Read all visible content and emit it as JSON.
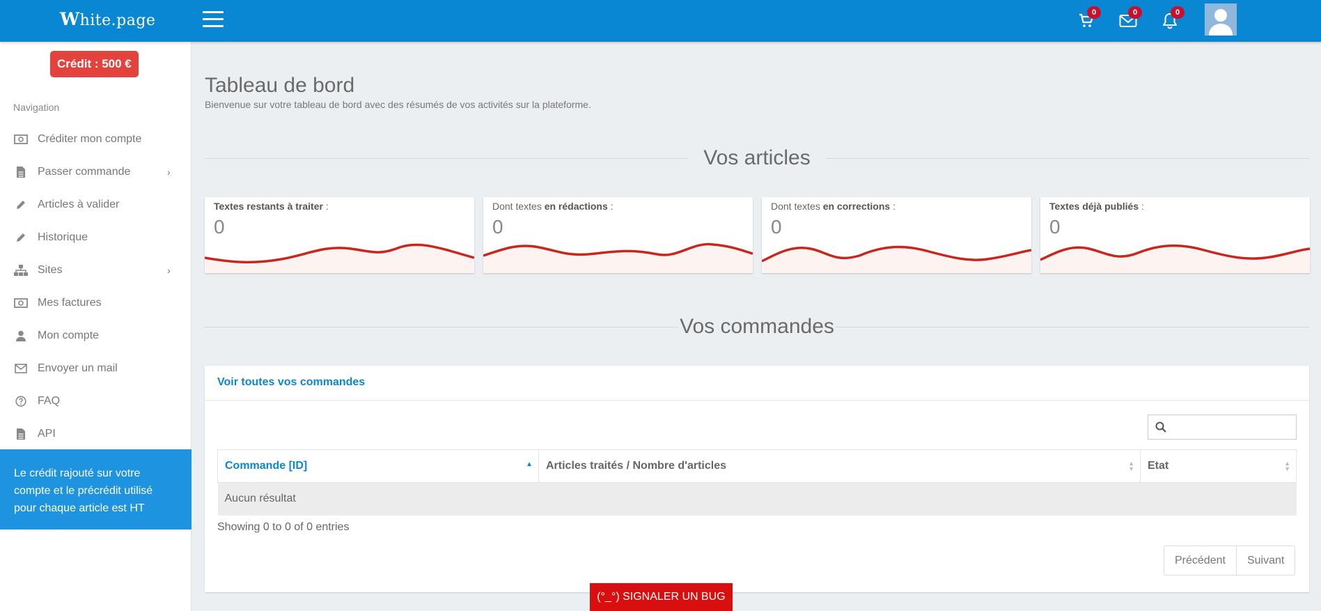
{
  "header": {
    "logo_initial": "W",
    "logo_rest": "hite.page",
    "cart_count": "0",
    "mail_count": "0",
    "bell_count": "0"
  },
  "sidebar": {
    "credit": "Crédit : 500 €",
    "heading": "Navigation",
    "items": [
      {
        "label": "Créditer mon compte",
        "icon": "money-icon"
      },
      {
        "label": "Passer commande",
        "icon": "file-icon",
        "expandable": true
      },
      {
        "label": "Articles à valider",
        "icon": "pencil-icon"
      },
      {
        "label": "Historique",
        "icon": "pencil-icon"
      },
      {
        "label": "Sites",
        "icon": "sitemap-icon",
        "expandable": true
      },
      {
        "label": "Mes factures",
        "icon": "money-icon"
      },
      {
        "label": "Mon compte",
        "icon": "user-icon"
      },
      {
        "label": "Envoyer un mail",
        "icon": "envelope-icon"
      },
      {
        "label": "FAQ",
        "icon": "question-icon"
      },
      {
        "label": "API",
        "icon": "file-icon"
      }
    ],
    "info": "Le crédit rajouté sur votre compte et le précrédit utilisé pour chaque article est HT"
  },
  "main": {
    "title": "Tableau de bord",
    "subtitle": "Bienvenue sur votre tableau de bord avec des résumés de vos activités sur la plateforme.",
    "articles_heading": "Vos articles",
    "cards": [
      {
        "pre": "",
        "bold": "Textes restants à traiter",
        "post": " :",
        "value": "0"
      },
      {
        "pre": "Dont textes ",
        "bold": "en rédactions",
        "post": " :",
        "value": "0"
      },
      {
        "pre": "Dont textes ",
        "bold": "en corrections",
        "post": " :",
        "value": "0"
      },
      {
        "pre": "",
        "bold": "Textes déjà publiés",
        "post": " :",
        "value": "0"
      }
    ],
    "orders_heading": "Vos commandes",
    "orders": {
      "link": "Voir toutes vos commandes",
      "search_placeholder": "",
      "columns": [
        "Commande [ID]",
        "Articles traités / Nombre d'articles",
        "Etat"
      ],
      "empty": "Aucun résultat",
      "showing": "Showing 0 to 0 of 0 entries",
      "prev": "Précédent",
      "next": "Suivant"
    }
  },
  "bug_button": "(°_°) SIGNALER UN BUG",
  "colors": {
    "primary": "#0a87d2",
    "credit": "#e4433d",
    "sparkline": "#c9271c",
    "bug": "#d90f0f"
  }
}
